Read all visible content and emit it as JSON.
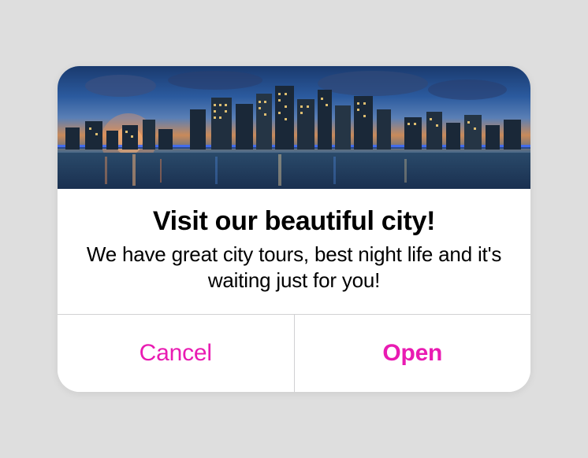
{
  "alert": {
    "title": "Visit our beautiful city!",
    "description": "We have great city tours, best night life and it's waiting just for you!",
    "buttons": {
      "cancel": "Cancel",
      "open": "Open"
    },
    "accent_color": "#e91bb2"
  }
}
